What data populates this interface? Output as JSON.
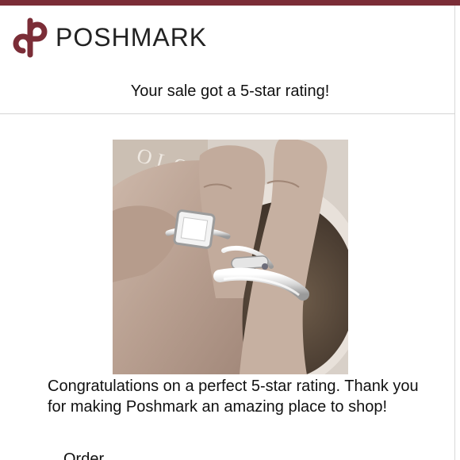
{
  "brand": {
    "name": "POSHMARK",
    "color": "#7b2d37",
    "logo_icon": "poshmark-p-logo-icon"
  },
  "email": {
    "subject_line": "Your sale got a 5-star rating!",
    "body": "Congratulations on a perfect 5-star rating. Thank you for making Poshmark an amazing place to shop!",
    "order_label": "Order"
  },
  "photo": {
    "description_icon": "product-photo-rings"
  }
}
